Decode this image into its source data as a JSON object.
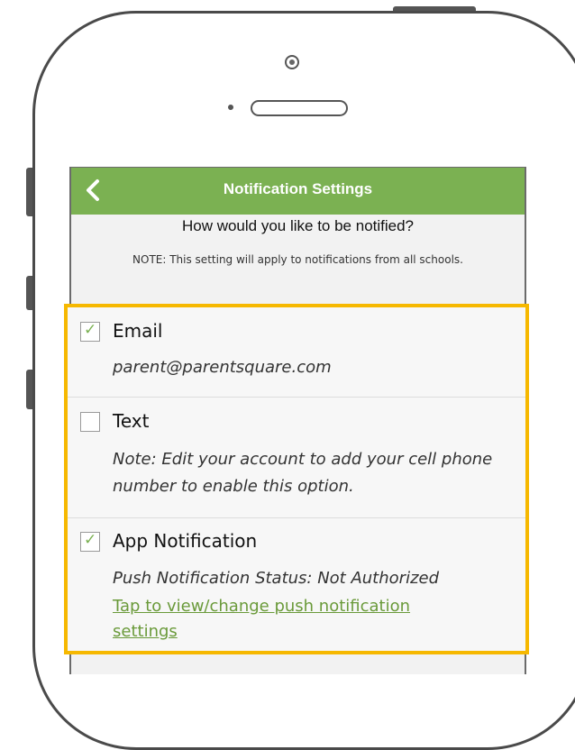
{
  "nav": {
    "title": "Notification Settings",
    "back_icon": "chevron-left-icon"
  },
  "header": {
    "prompt": "How would you like to be notified?",
    "note": "NOTE: This setting will apply to notifications from all schools."
  },
  "options": [
    {
      "label": "Email",
      "checked": true,
      "detail": "parent@parentsquare.com"
    },
    {
      "label": "Text",
      "checked": false,
      "detail": "Note: Edit your account to add your cell phone number to enable this option."
    },
    {
      "label": "App Notification",
      "checked": true,
      "detail": "Push Notification Status: Not Authorized",
      "link": "Tap to view/change push notification settings"
    }
  ],
  "colors": {
    "nav_bar": "#7bb152",
    "highlight_border": "#f6b800",
    "check_mark": "#7bb152",
    "link": "#6a9a3a"
  },
  "icons": {
    "check_mark": "✓"
  }
}
